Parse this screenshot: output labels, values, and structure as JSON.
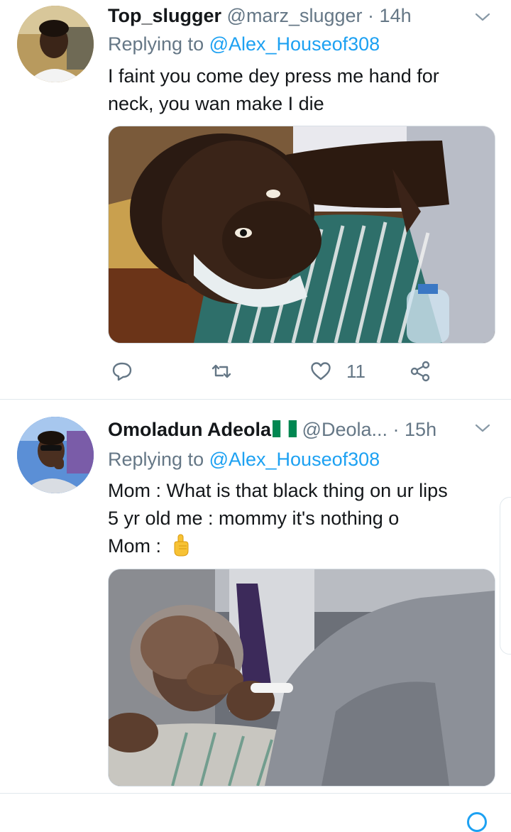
{
  "tweets": [
    {
      "display_name": "Top_slugger",
      "handle": "@marz_slugger",
      "dot": "·",
      "time": "14h",
      "replying_prefix": "Replying to ",
      "replying_to": "@Alex_Houseof308",
      "text_lines": [
        "I faint you come dey press me hand for",
        "neck, you wan make I die"
      ],
      "reply_count": "",
      "retweet_count": "",
      "like_count": "11",
      "avatar_icon": "user-avatar",
      "media_icon": "photo-court-man"
    },
    {
      "display_name": "Omoladun Adeola",
      "handle": "@Deola...",
      "dot": "·",
      "time": "15h",
      "replying_prefix": "Replying to ",
      "replying_to": "@Alex_Houseof308",
      "text_lines": [
        "Mom : What is that black thing on ur lips",
        "5 yr old me : mommy it's nothing o",
        "Mom : "
      ],
      "flag_icon": "nigeria-flag-emoji",
      "emoji_icon": "index-pointing-up-emoji",
      "avatar_icon": "user-avatar",
      "media_icon": "photo-hand-on-face"
    }
  ],
  "colors": {
    "link": "#1da1f2",
    "secondary_text": "#657786",
    "primary_text": "#14171a",
    "divider": "#e1e8ed",
    "flag_green": "#008751"
  }
}
